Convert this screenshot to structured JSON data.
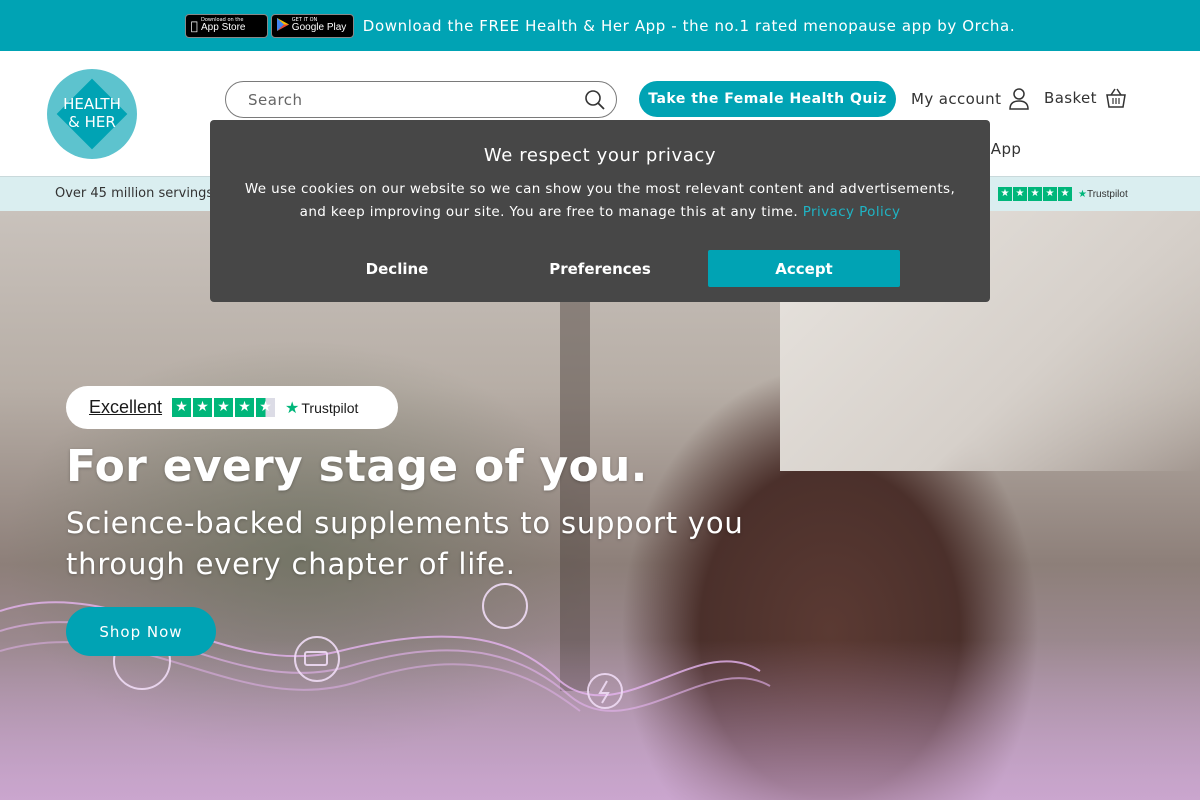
{
  "announcement": {
    "app_store_small": "Download on the",
    "app_store_big": "App Store",
    "google_play_small": "GET IT ON",
    "google_play_big": "Google Play",
    "text": "Download the FREE Health & Her App - the no.1 rated menopause app by Orcha."
  },
  "header": {
    "logo_line1": "HEALTH",
    "logo_line2": "& HER",
    "search_placeholder": "Search",
    "quiz_label": "Take the Female Health Quiz",
    "account_label": "My account",
    "basket_label": "Basket",
    "nav_partial": "e App"
  },
  "strip": {
    "left_text": "Over 45 million servings",
    "trustpilot_label": "Trustpilot"
  },
  "cookie": {
    "title": "We respect your privacy",
    "body": "We use cookies on our website so we can show you the most relevant content and advertisements, and keep improving our site. You are free to manage this at any time.",
    "link": "Privacy Policy",
    "decline": "Decline",
    "preferences": "Preferences",
    "accept": "Accept"
  },
  "hero": {
    "trustpilot_rating": "Excellent",
    "trustpilot_brand": "Trustpilot",
    "title": "For every stage of you.",
    "subtitle": "Science-backed supplements to support you through every chapter of life.",
    "cta": "Shop Now"
  },
  "colors": {
    "brand_teal": "#00a3b4",
    "modal_bg": "#474747",
    "trustpilot_green": "#00b67a",
    "strip_bg": "#daeef0"
  }
}
